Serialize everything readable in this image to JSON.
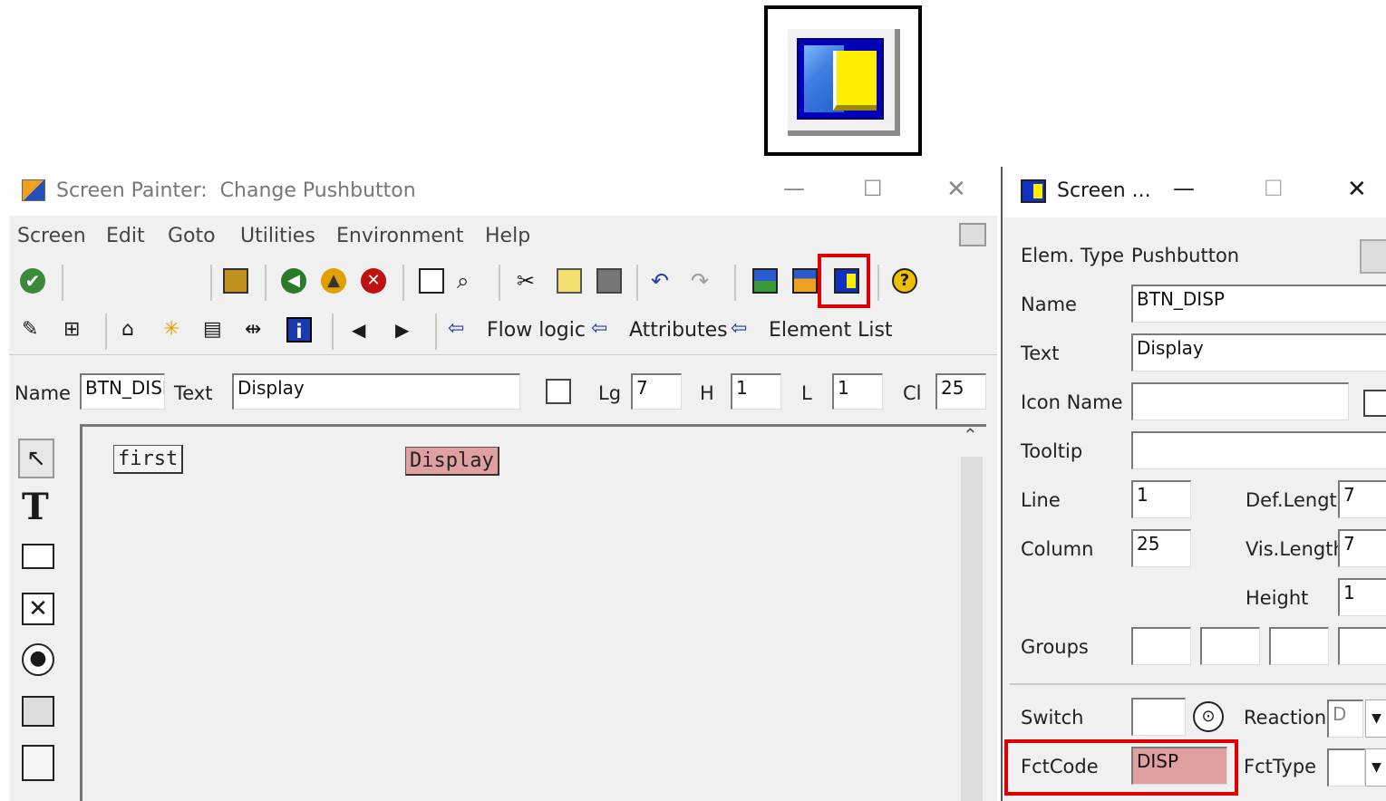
{
  "window": {
    "title": "Screen Painter:  Change Pushbutton",
    "minimize": "—",
    "maximize": "☐",
    "close": "✕"
  },
  "menu": [
    "Screen",
    "Edit",
    "Goto",
    "Utilities",
    "Environment",
    "Help"
  ],
  "toolbar2": {
    "flow_logic": "Flow logic",
    "attributes": "Attributes",
    "element_list": "Element List"
  },
  "fieldbar": {
    "name_label": "Name",
    "name_value": "BTN_DISP",
    "text_label": "Text",
    "text_value": "Display",
    "lg_label": "Lg",
    "lg_value": "7",
    "h_label": "H",
    "h_value": "1",
    "l_label": "L",
    "l_value": "1",
    "cl_label": "Cl",
    "cl_value": "25"
  },
  "canvas": {
    "button1": "first",
    "button2": "Display"
  },
  "panel": {
    "title": "Screen ...",
    "elem_type_label": "Elem. Type",
    "elem_type_value": "Pushbutton",
    "name_label": "Name",
    "name_value": "BTN_DISP",
    "text_label": "Text",
    "text_value": "Display",
    "icon_name_label": "Icon Name",
    "icon_name_value": "",
    "tooltip_label": "Tooltip",
    "tooltip_value": "",
    "line_label": "Line",
    "line_value": "1",
    "def_length_label": "Def.Lengt",
    "def_length_value": "7",
    "column_label": "Column",
    "column_value": "25",
    "vis_length_label": "Vis.Length",
    "vis_length_value": "7",
    "height_label": "Height",
    "height_value": "1",
    "groups_label": "Groups",
    "switch_label": "Switch",
    "reaction_label": "Reaction",
    "reaction_value": "D",
    "fctcode_label": "FctCode",
    "fctcode_value": "DISP",
    "fcttype_label": "FctType"
  },
  "colors": {
    "highlight": "#e00000",
    "pushbutton_fill": "#e0a0a0",
    "window_bg": "#f0f0f0"
  }
}
